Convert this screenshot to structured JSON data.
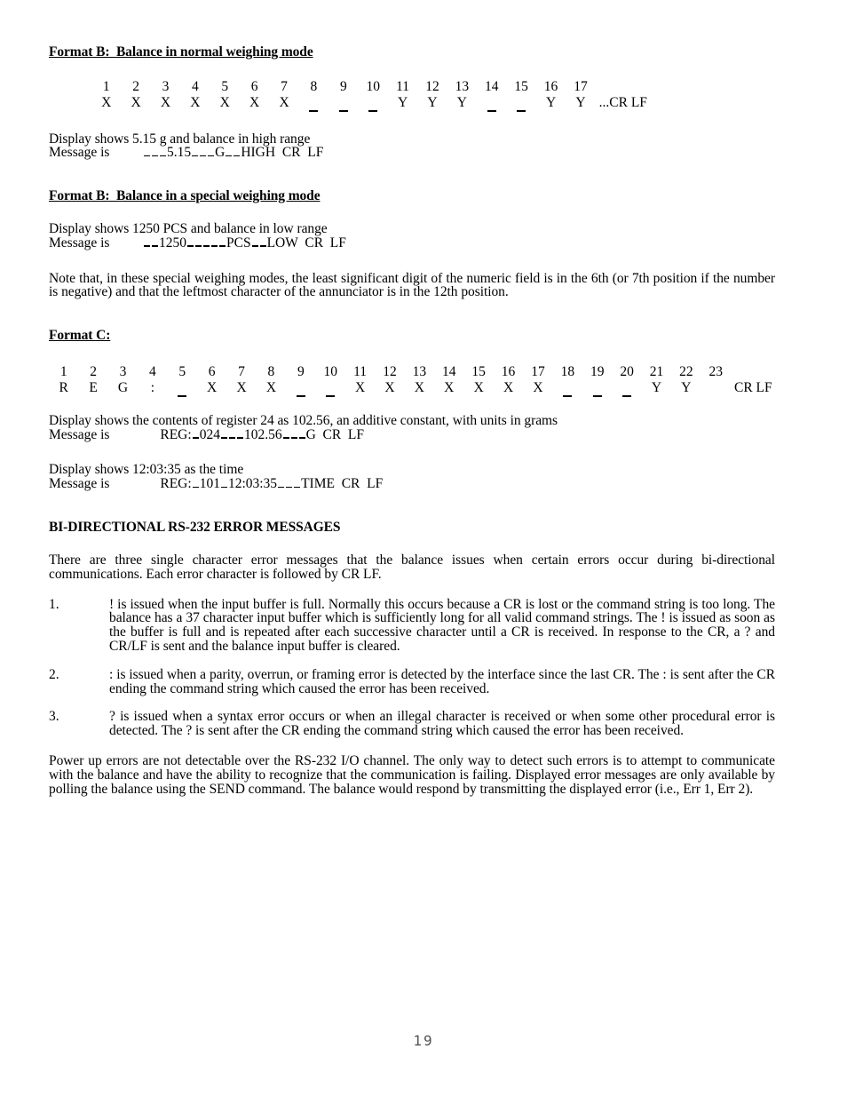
{
  "document": {
    "page_number": "19"
  },
  "format_b_normal": {
    "heading": "Format B:  Balance in normal weighing mode",
    "grid": {
      "positions": [
        "1",
        "2",
        "3",
        "4",
        "5",
        "6",
        "7",
        "8",
        "9",
        "10",
        "11",
        "12",
        "13",
        "14",
        "15",
        "16",
        "17"
      ],
      "characters": [
        "X",
        "X",
        "X",
        "X",
        "X",
        "X",
        "X",
        "_",
        "_",
        "_",
        "Y",
        "Y",
        "Y",
        "_",
        "_",
        "Y",
        "Y"
      ],
      "tail": "...CR LF"
    },
    "display_line": "Display shows 5.15 g and balance in high range",
    "message_label": "Message is",
    "message_value": "_ _ _5.15_ _ _G_ _HIGH  CR  LF",
    "message_parts": [
      "_",
      "_",
      "_",
      "5.15",
      "_",
      "_",
      "_",
      "G",
      "_",
      "_",
      "HIGH",
      "CR",
      "LF"
    ]
  },
  "format_b_special": {
    "heading": "Format B:  Balance in a special weighing mode",
    "display_line": "Display shows 1250 PCS and balance in low range",
    "message_label": "Message is",
    "message_value": "_ _1250_ _ _ _ _PCS_ _LOW  CR  LF",
    "note": "Note that, in these special weighing modes, the least significant digit of the numeric field is in the 6th (or 7th position if the number is negative) and that the leftmost character of the annunciator is in the 12th position."
  },
  "format_c": {
    "heading": "Format C:",
    "grid": {
      "positions": [
        "1",
        "2",
        "3",
        "4",
        "5",
        "6",
        "7",
        "8",
        "9",
        "10",
        "11",
        "12",
        "13",
        "14",
        "15",
        "16",
        "17",
        "18",
        "19",
        "20",
        "21",
        "22",
        "23"
      ],
      "characters": [
        "R",
        "E",
        "G",
        ":",
        "_",
        "X",
        "X",
        "X",
        "_",
        "_",
        "X",
        "X",
        "X",
        "X",
        "X",
        "X",
        "X",
        "_",
        "_",
        "_",
        "Y",
        "Y",
        ""
      ],
      "tail": "CR LF"
    },
    "example_1": {
      "display_line": "Display shows the contents of register 24 as 102.56, an additive constant, with units in grams",
      "message_label": "Message is",
      "message_value": "REG:_024_ _ _102.56_ _ _G  CR  LF"
    },
    "example_2": {
      "display_line": "Display shows 12:03:35 as the time",
      "message_label": "Message is",
      "message_value": "REG:_101_12:03:35_ _ _TIME  CR  LF"
    }
  },
  "error_section": {
    "heading": "BI-DIRECTIONAL RS-232 ERROR MESSAGES",
    "intro": "There are three single character error messages that the balance issues when certain errors occur during bi-directional communications.  Each error character is followed by CR LF.",
    "items": [
      {
        "number": "1.",
        "text": "! is issued when the input buffer is full.  Normally this occurs because a CR is lost or the command string is too long.  The balance has a 37 character input buffer which is sufficiently long for all valid command strings.  The ! is issued as soon as the buffer is full and is repeated after each successive character until a CR is received.  In response to the CR, a ? and CR/LF is sent and the balance input buffer is cleared."
      },
      {
        "number": "2.",
        "text": ": is issued when a parity, overrun, or framing error is detected by the interface since the last CR.  The : is sent after the CR ending the command string which caused the error has been received."
      },
      {
        "number": "3.",
        "text": "? is issued when a syntax error occurs or when an illegal character is received or when some other procedural error is detected.  The ? is sent after the CR ending the command string which caused the error has been received."
      }
    ],
    "closing": "Power up errors are not detectable over the RS-232 I/O channel.  The only way to detect such errors is to attempt to communicate with the balance and have the ability to recognize that the communication is failing.  Displayed error messages are only available by polling the balance using the SEND command.  The balance would respond by transmitting the displayed error (i.e., Err 1, Err 2)."
  }
}
